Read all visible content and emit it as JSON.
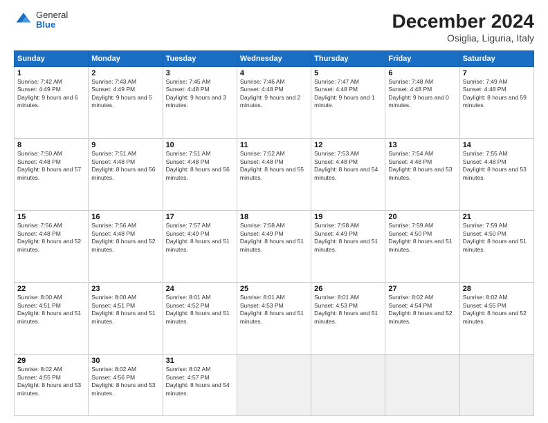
{
  "logo": {
    "general": "General",
    "blue": "Blue"
  },
  "header": {
    "title": "December 2024",
    "subtitle": "Osiglia, Liguria, Italy"
  },
  "days_of_week": [
    "Sunday",
    "Monday",
    "Tuesday",
    "Wednesday",
    "Thursday",
    "Friday",
    "Saturday"
  ],
  "weeks": [
    [
      {
        "day": "1",
        "sunrise": "7:42 AM",
        "sunset": "4:49 PM",
        "daylight": "9 hours and 6 minutes."
      },
      {
        "day": "2",
        "sunrise": "7:43 AM",
        "sunset": "4:49 PM",
        "daylight": "9 hours and 5 minutes."
      },
      {
        "day": "3",
        "sunrise": "7:45 AM",
        "sunset": "4:48 PM",
        "daylight": "9 hours and 3 minutes."
      },
      {
        "day": "4",
        "sunrise": "7:46 AM",
        "sunset": "4:48 PM",
        "daylight": "9 hours and 2 minutes."
      },
      {
        "day": "5",
        "sunrise": "7:47 AM",
        "sunset": "4:48 PM",
        "daylight": "9 hours and 1 minute."
      },
      {
        "day": "6",
        "sunrise": "7:48 AM",
        "sunset": "4:48 PM",
        "daylight": "9 hours and 0 minutes."
      },
      {
        "day": "7",
        "sunrise": "7:49 AM",
        "sunset": "4:48 PM",
        "daylight": "8 hours and 59 minutes."
      }
    ],
    [
      {
        "day": "8",
        "sunrise": "7:50 AM",
        "sunset": "4:48 PM",
        "daylight": "8 hours and 57 minutes."
      },
      {
        "day": "9",
        "sunrise": "7:51 AM",
        "sunset": "4:48 PM",
        "daylight": "8 hours and 56 minutes."
      },
      {
        "day": "10",
        "sunrise": "7:51 AM",
        "sunset": "4:48 PM",
        "daylight": "8 hours and 56 minutes."
      },
      {
        "day": "11",
        "sunrise": "7:52 AM",
        "sunset": "4:48 PM",
        "daylight": "8 hours and 55 minutes."
      },
      {
        "day": "12",
        "sunrise": "7:53 AM",
        "sunset": "4:48 PM",
        "daylight": "8 hours and 54 minutes."
      },
      {
        "day": "13",
        "sunrise": "7:54 AM",
        "sunset": "4:48 PM",
        "daylight": "8 hours and 53 minutes."
      },
      {
        "day": "14",
        "sunrise": "7:55 AM",
        "sunset": "4:48 PM",
        "daylight": "8 hours and 53 minutes."
      }
    ],
    [
      {
        "day": "15",
        "sunrise": "7:56 AM",
        "sunset": "4:48 PM",
        "daylight": "8 hours and 52 minutes."
      },
      {
        "day": "16",
        "sunrise": "7:56 AM",
        "sunset": "4:48 PM",
        "daylight": "8 hours and 52 minutes."
      },
      {
        "day": "17",
        "sunrise": "7:57 AM",
        "sunset": "4:49 PM",
        "daylight": "8 hours and 51 minutes."
      },
      {
        "day": "18",
        "sunrise": "7:58 AM",
        "sunset": "4:49 PM",
        "daylight": "8 hours and 51 minutes."
      },
      {
        "day": "19",
        "sunrise": "7:58 AM",
        "sunset": "4:49 PM",
        "daylight": "8 hours and 51 minutes."
      },
      {
        "day": "20",
        "sunrise": "7:59 AM",
        "sunset": "4:50 PM",
        "daylight": "8 hours and 51 minutes."
      },
      {
        "day": "21",
        "sunrise": "7:59 AM",
        "sunset": "4:50 PM",
        "daylight": "8 hours and 51 minutes."
      }
    ],
    [
      {
        "day": "22",
        "sunrise": "8:00 AM",
        "sunset": "4:51 PM",
        "daylight": "8 hours and 51 minutes."
      },
      {
        "day": "23",
        "sunrise": "8:00 AM",
        "sunset": "4:51 PM",
        "daylight": "8 hours and 51 minutes."
      },
      {
        "day": "24",
        "sunrise": "8:01 AM",
        "sunset": "4:52 PM",
        "daylight": "8 hours and 51 minutes."
      },
      {
        "day": "25",
        "sunrise": "8:01 AM",
        "sunset": "4:53 PM",
        "daylight": "8 hours and 51 minutes."
      },
      {
        "day": "26",
        "sunrise": "8:01 AM",
        "sunset": "4:53 PM",
        "daylight": "8 hours and 51 minutes."
      },
      {
        "day": "27",
        "sunrise": "8:02 AM",
        "sunset": "4:54 PM",
        "daylight": "8 hours and 52 minutes."
      },
      {
        "day": "28",
        "sunrise": "8:02 AM",
        "sunset": "4:55 PM",
        "daylight": "8 hours and 52 minutes."
      }
    ],
    [
      {
        "day": "29",
        "sunrise": "8:02 AM",
        "sunset": "4:55 PM",
        "daylight": "8 hours and 53 minutes."
      },
      {
        "day": "30",
        "sunrise": "8:02 AM",
        "sunset": "4:56 PM",
        "daylight": "8 hours and 53 minutes."
      },
      {
        "day": "31",
        "sunrise": "8:02 AM",
        "sunset": "4:57 PM",
        "daylight": "8 hours and 54 minutes."
      },
      null,
      null,
      null,
      null
    ]
  ]
}
